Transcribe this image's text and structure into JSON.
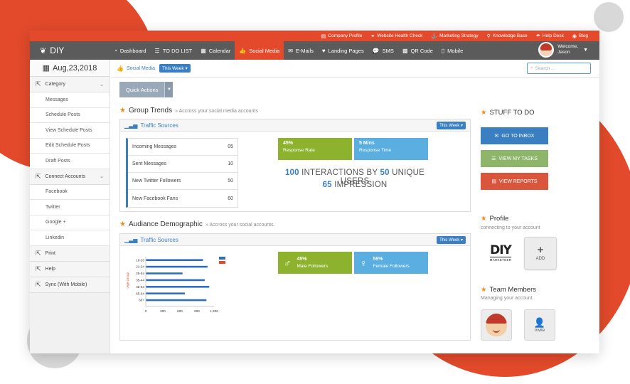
{
  "toplinks": [
    {
      "icon": "document-icon",
      "label": "Company Profile"
    },
    {
      "icon": "link-icon",
      "label": "Website Health Check"
    },
    {
      "icon": "anchor-icon",
      "label": "Marketing Strategy"
    },
    {
      "icon": "pin-icon",
      "label": "Knowledge Base"
    },
    {
      "icon": "umbrella-icon",
      "label": "Help Desk"
    },
    {
      "icon": "rss-icon",
      "label": "Blog"
    }
  ],
  "brand": {
    "name": "DIY"
  },
  "nav": [
    {
      "icon": "dashboard-icon",
      "label": "Dashboard"
    },
    {
      "icon": "list-icon",
      "label": "TO DO LIST"
    },
    {
      "icon": "calendar-icon",
      "label": "Calendar"
    },
    {
      "icon": "thumbs-up-icon",
      "label": "Social Media"
    },
    {
      "icon": "mail-icon",
      "label": "E-Mails"
    },
    {
      "icon": "heart-icon",
      "label": "Landing Pages"
    },
    {
      "icon": "chat-icon",
      "label": "SMS"
    },
    {
      "icon": "qr-icon",
      "label": "QR Code"
    },
    {
      "icon": "mobile-icon",
      "label": "Mobile"
    }
  ],
  "nav_active": "Social Media",
  "user": {
    "welcome": "Welcome,",
    "name": "Jason"
  },
  "sidebar": {
    "date": "Aug,23,2018",
    "category": "Category",
    "category_items": [
      "Messages",
      "Schedule Posts",
      "View Schedule Posts",
      "Edit Schedule Posts",
      "Draft Posts"
    ],
    "connect": "Connect Accounts",
    "connect_items": [
      "Facebook",
      "Twitter",
      "Google +",
      "Linkedin"
    ],
    "print": "Print",
    "help": "Help",
    "sync": "Sync (With Mobile)"
  },
  "crumb": {
    "label": "Social Media",
    "period": "This Week"
  },
  "search": {
    "placeholder": "Search ..."
  },
  "quick_actions": "Quick Actions",
  "group_trends": {
    "title": "Group Trends",
    "sub": "» Accross your social media accounts",
    "panel_title": "Traffic Sources",
    "period": "This Week",
    "stats": [
      {
        "label": "Incoming Messages",
        "value": "05"
      },
      {
        "label": "Sent Messages",
        "value": "10"
      },
      {
        "label": "New Twitter Followers",
        "value": "50"
      },
      {
        "label": "New Facebook Fans",
        "value": "60"
      }
    ],
    "tile1": {
      "value": "45%",
      "label": "Response Rate"
    },
    "tile2": {
      "value": "5 Mins",
      "label": "Response Time"
    },
    "interactions": "100",
    "interactions_text": "INTERACTIONS BY",
    "users": "50",
    "users_text": "UNIQUE USERS",
    "impressions": "65",
    "impressions_text": "IMPRESSION"
  },
  "audience": {
    "title": "Audiance Demographic",
    "sub": "» Accross your social accounts.",
    "panel_title": "Traffic Sources",
    "period": "This Week",
    "male": {
      "value": "45%",
      "label": "Male Followers"
    },
    "female": {
      "value": "55%",
      "label": "Female Followers"
    }
  },
  "chart_data": {
    "type": "bar",
    "orientation": "horizontal",
    "categories": [
      "18-20",
      "21-24",
      "25-54",
      "35-44",
      "45-64",
      "65-64",
      "65+"
    ],
    "values": [
      1000,
      1080,
      640,
      1030,
      1110,
      680,
      1060
    ],
    "xlim": [
      0,
      1200
    ],
    "xticks": [
      "0",
      "300",
      "600",
      "900",
      "1,200"
    ],
    "ylabel": "Age Group",
    "legend_colors": [
      "#2f6fbf",
      "#e24a2b"
    ],
    "bar_color": "#2f6fbf"
  },
  "stuff_to_do": {
    "title": "STUFF TO DO",
    "inbox": "GO TO INBOX",
    "tasks": "VIEW MY TASKS",
    "reports": "VIEW REPORTS"
  },
  "profile": {
    "title": "Profile",
    "sub": "connecting to your account",
    "logo_big": "DIY",
    "logo_small": "MARKETEER",
    "add": "ADD"
  },
  "team": {
    "title": "Team Members",
    "sub": "Managing your account",
    "invite": "Invite"
  },
  "colors": {
    "accent": "#e24a2b",
    "blue": "#3a7fc1",
    "green": "#8db32e",
    "light_blue": "#5aaee0",
    "nav": "#5b5b5b"
  }
}
